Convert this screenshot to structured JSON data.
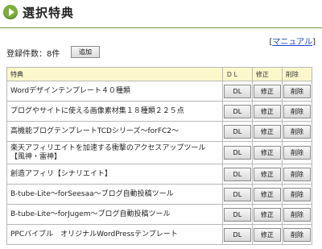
{
  "page": {
    "title": "選択特典",
    "manual_link": "マニュアル",
    "manual_bracket_open": "[",
    "manual_bracket_close": "]",
    "count_label": "登録件数：8件",
    "add_button": "追加"
  },
  "table": {
    "headers": [
      "特典",
      "ＤＬ",
      "修正",
      "削除"
    ],
    "rows": [
      {
        "name": "Wordデザインテンプレート４０種類",
        "dl": "DL",
        "edit": "修正",
        "delete": "削除"
      },
      {
        "name": "ブログやサイトに使える画像素材集１８種類２２５点",
        "dl": "DL",
        "edit": "修正",
        "delete": "削除"
      },
      {
        "name": "高機能ブログテンプレートTCDシリーズ～forFC2～",
        "dl": "DL",
        "edit": "修正",
        "delete": "削除"
      },
      {
        "name": "楽天アフィリエイトを加速する衝撃のアクセスアップツール【風神・雷神】",
        "dl": "DL",
        "edit": "修正",
        "delete": "削除"
      },
      {
        "name": "創造アフィリ【シナリエイト】",
        "dl": "DL",
        "edit": "修正",
        "delete": "削除"
      },
      {
        "name": "B-tube-Lite～forSeesaa～ブログ自動投稿ツール",
        "dl": "DL",
        "edit": "修正",
        "delete": "削除"
      },
      {
        "name": "B-tube-Lite～forJugem～ブログ自動投稿ツール",
        "dl": "DL",
        "edit": "修正",
        "delete": "削除"
      },
      {
        "name": "PPCバイブル　オリジナルWordPressテンプレート",
        "dl": "DL",
        "edit": "修正",
        "delete": "削除"
      }
    ]
  },
  "colors": {
    "accent": "#7cae3a",
    "header_bg": "#fdf8cc",
    "link": "#1a44c8"
  }
}
